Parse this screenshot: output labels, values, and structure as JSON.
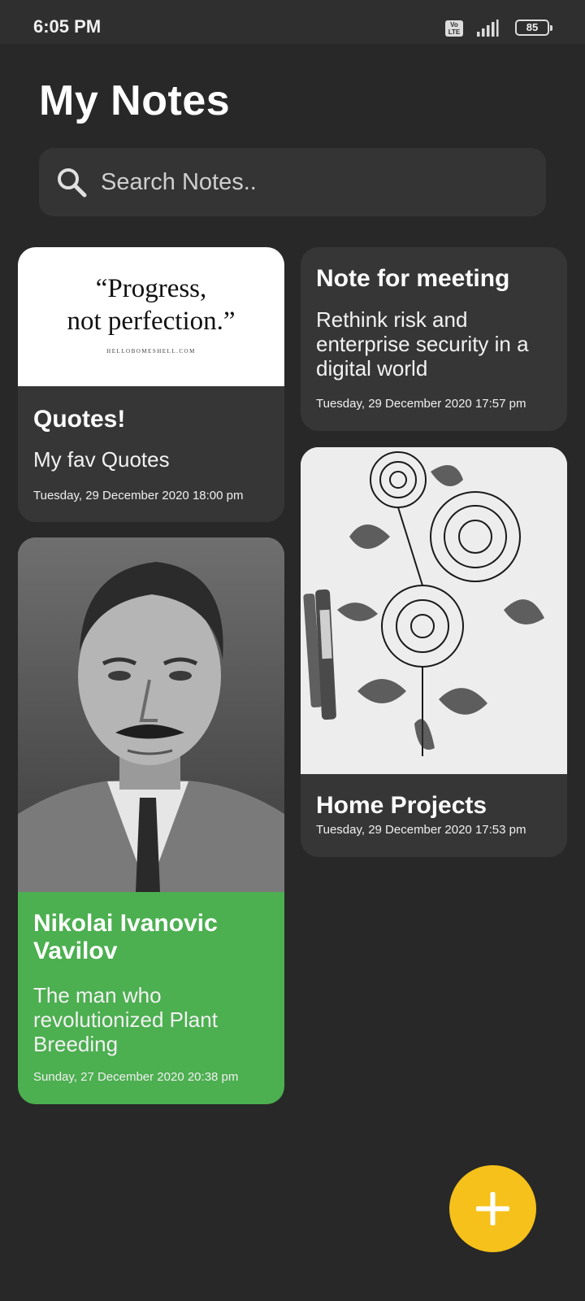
{
  "status_bar": {
    "time": "6:05 PM",
    "volte_label": "Vo LTE",
    "battery_level": "85",
    "icons": [
      "volte-icon",
      "signal-icon",
      "battery-icon"
    ]
  },
  "header": {
    "title": "My Notes"
  },
  "search": {
    "placeholder": "Search Notes..",
    "icon": "search-icon"
  },
  "notes": [
    {
      "title": "Quotes!",
      "subtitle": "My fav Quotes",
      "date": "Tuesday, 29 December 2020 18:00 pm",
      "image": {
        "quote_line1": "“Progress,",
        "quote_line2": "not perfection.”",
        "site": "HELLOBOMESHELL.COM"
      },
      "color": "#363636"
    },
    {
      "title": "Note for meeting",
      "subtitle": "Rethink risk and enterprise security in a digital world",
      "date": "Tuesday, 29 December 2020 17:57 pm",
      "color": "#363636"
    },
    {
      "title": "Home Projects",
      "date": "Tuesday, 29 December 2020 17:53 pm",
      "image": "rose-sketch-photo",
      "color": "#363636"
    },
    {
      "title": "Nikolai Ivanovic Vavilov",
      "subtitle": "The man who revolutionized Plant Breeding",
      "date": "Sunday, 27 December 2020 20:38 pm",
      "image": "portrait-photo",
      "color": "#4caf50"
    }
  ],
  "fab": {
    "icon": "plus-icon",
    "color": "#f5c11a"
  },
  "colors": {
    "background": "#282828",
    "card": "#363636",
    "accent_green": "#4caf50",
    "accent_yellow": "#f5c11a"
  }
}
